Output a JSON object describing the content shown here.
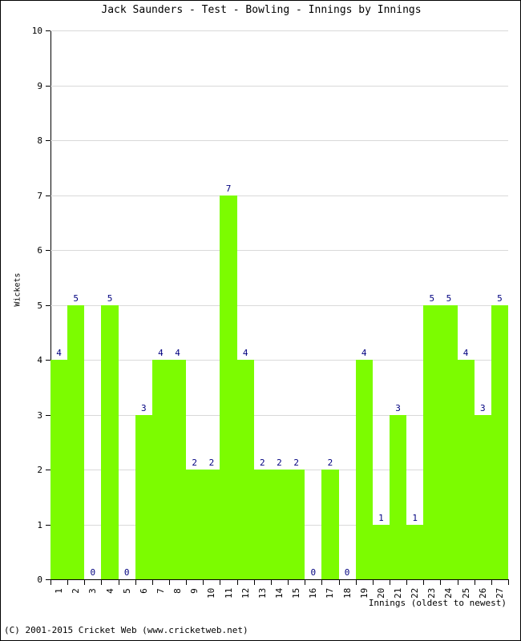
{
  "chart_data": {
    "type": "bar",
    "title": "Jack Saunders - Test - Bowling - Innings by Innings",
    "xlabel": "Innings (oldest to newest)",
    "ylabel": "Wickets",
    "categories": [
      "1",
      "2",
      "3",
      "4",
      "5",
      "6",
      "7",
      "8",
      "9",
      "10",
      "11",
      "12",
      "13",
      "14",
      "15",
      "16",
      "17",
      "18",
      "19",
      "20",
      "21",
      "22",
      "23",
      "24",
      "25",
      "26",
      "27"
    ],
    "values": [
      4,
      5,
      0,
      5,
      0,
      3,
      4,
      4,
      2,
      2,
      7,
      4,
      2,
      2,
      2,
      0,
      2,
      0,
      4,
      1,
      3,
      1,
      5,
      5,
      4,
      3,
      5
    ],
    "data_labels": [
      "4",
      "5",
      "0",
      "5",
      "0",
      "3",
      "4",
      "4",
      "2",
      "2",
      "7",
      "4",
      "2",
      "2",
      "2",
      "0",
      "2",
      "0",
      "4",
      "1",
      "3",
      "1",
      "5",
      "5",
      "4",
      "3",
      "5"
    ],
    "ylim": [
      0,
      10
    ],
    "yticks": [
      0,
      1,
      2,
      3,
      4,
      5,
      6,
      7,
      8,
      9,
      10
    ],
    "ytick_labels": [
      "0",
      "1",
      "2",
      "3",
      "4",
      "5",
      "6",
      "7",
      "8",
      "9",
      "10"
    ],
    "grid": true,
    "legend": false,
    "bar_color": "#7cfc00",
    "label_color": "#000080",
    "gridline_color": "#d9d9d9",
    "axis_color": "#000000"
  },
  "footer": {
    "copyright": "(C) 2001-2015 Cricket Web (www.cricketweb.net)"
  }
}
